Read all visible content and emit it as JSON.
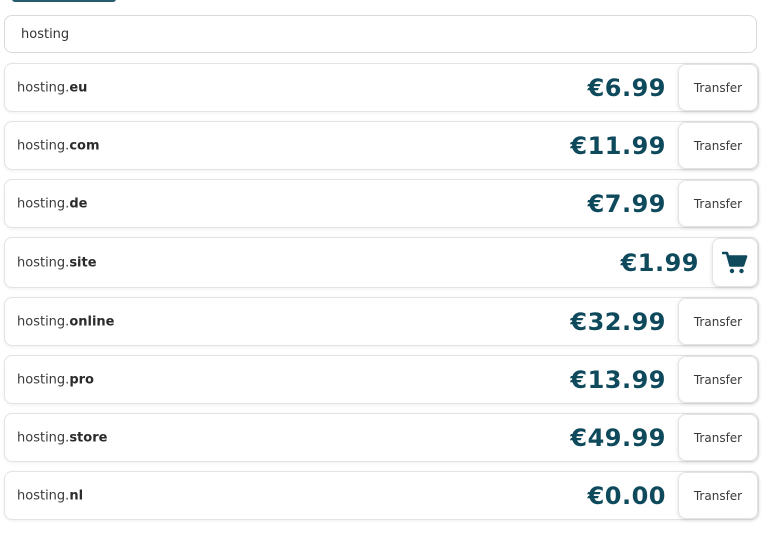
{
  "search": {
    "value": "hosting"
  },
  "results": [
    {
      "sld": "hosting.",
      "tld": "eu",
      "price": "€6.99",
      "action": "Transfer",
      "action_type": "transfer"
    },
    {
      "sld": "hosting.",
      "tld": "com",
      "price": "€11.99",
      "action": "Transfer",
      "action_type": "transfer"
    },
    {
      "sld": "hosting.",
      "tld": "de",
      "price": "€7.99",
      "action": "Transfer",
      "action_type": "transfer"
    },
    {
      "sld": "hosting.",
      "tld": "site",
      "price": "€1.99",
      "action": "",
      "action_type": "cart",
      "icon": "shopping-cart-icon"
    },
    {
      "sld": "hosting.",
      "tld": "online",
      "price": "€32.99",
      "action": "Transfer",
      "action_type": "transfer"
    },
    {
      "sld": "hosting.",
      "tld": "pro",
      "price": "€13.99",
      "action": "Transfer",
      "action_type": "transfer"
    },
    {
      "sld": "hosting.",
      "tld": "store",
      "price": "€49.99",
      "action": "Transfer",
      "action_type": "transfer"
    },
    {
      "sld": "hosting.",
      "tld": "nl",
      "price": "€0.00",
      "action": "Transfer",
      "action_type": "transfer"
    }
  ],
  "colors": {
    "price": "#0f4a5c",
    "border": "#e3e3e3"
  }
}
